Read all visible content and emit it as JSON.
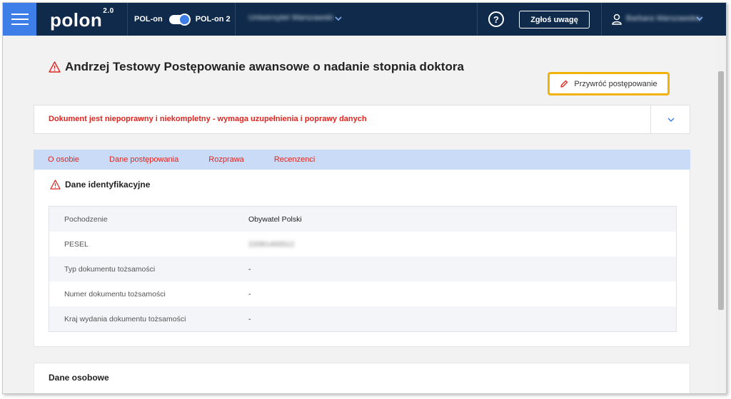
{
  "colors": {
    "topbar": "#0f2a4a",
    "accent": "#3e7ee8",
    "error": "#e0241f",
    "highlight": "#f2b20a",
    "tabs_bg": "#c9dbf6"
  },
  "header": {
    "logo": "polon",
    "logo_version": "2.0",
    "toggle_left": "POL-on",
    "toggle_right": "POL-on 2",
    "university": "Uniwersytet Warszawski",
    "help_label": "?",
    "report_button": "Zgłoś uwagę",
    "username": "Barbara Warszawska"
  },
  "page": {
    "title": "Andrzej Testowy Postępowanie awansowe o nadanie stopnia doktora",
    "restore_button": "Przywróć postępowanie"
  },
  "alert": {
    "message": "Dokument jest niepoprawny i niekompletny - wymaga uzupełnienia i poprawy danych"
  },
  "tabs": [
    {
      "label": "O osobie"
    },
    {
      "label": "Dane postępowania"
    },
    {
      "label": "Rozprawa"
    },
    {
      "label": "Recenzenci"
    }
  ],
  "identification": {
    "title": "Dane identyfikacyjne",
    "rows": [
      {
        "label": "Pochodzenie",
        "value": "Obywatel Polski"
      },
      {
        "label": "PESEL",
        "value": "22081400512"
      },
      {
        "label": "Typ dokumentu tożsamości",
        "value": "-"
      },
      {
        "label": "Numer dokumentu tożsamości",
        "value": "-"
      },
      {
        "label": "Kraj wydania dokumentu tożsamości",
        "value": "-"
      }
    ]
  },
  "personal": {
    "title": "Dane osobowe"
  }
}
